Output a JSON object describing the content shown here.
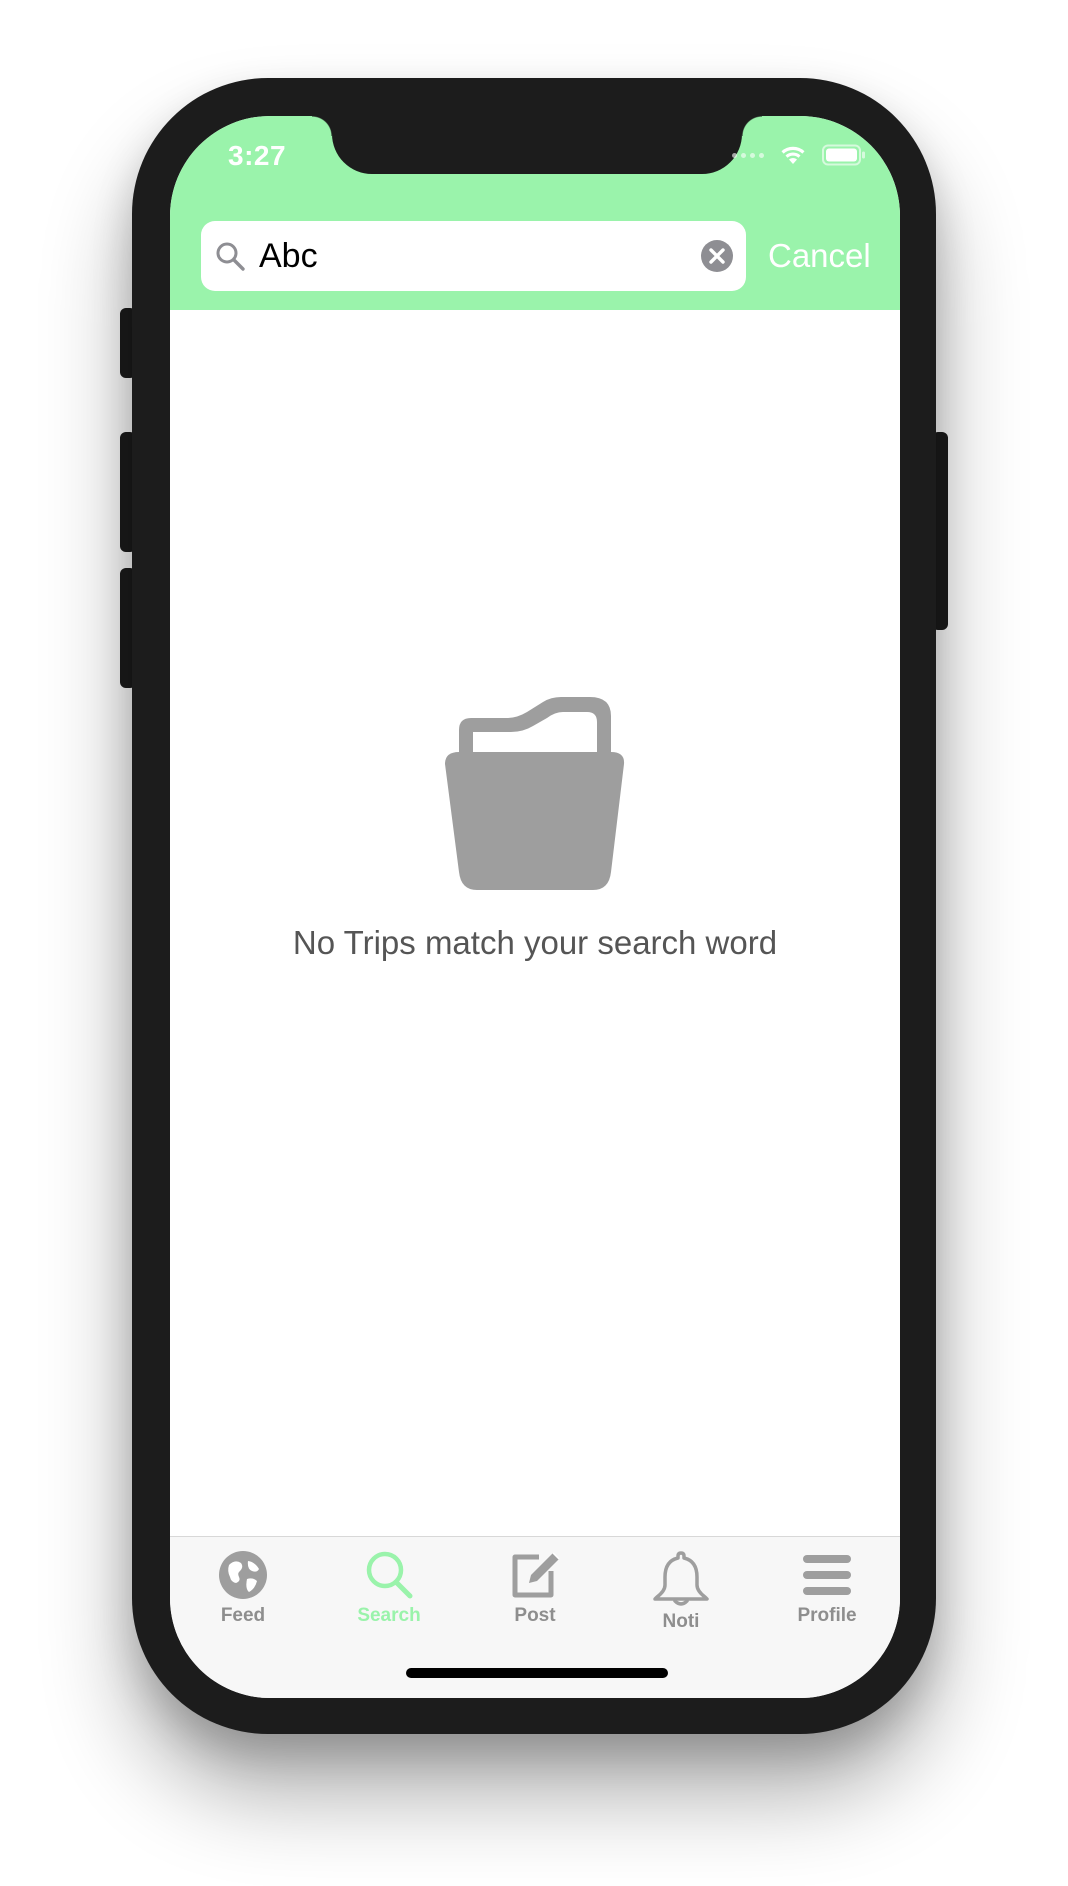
{
  "status_bar": {
    "time": "3:27"
  },
  "search": {
    "query": "Abc",
    "cancel_label": "Cancel"
  },
  "empty_state": {
    "message": "No Trips match your search word",
    "icon": "folder-icon"
  },
  "tab_bar": {
    "active": "Search",
    "items": [
      {
        "label": "Feed",
        "icon": "globe-icon"
      },
      {
        "label": "Search",
        "icon": "search-icon"
      },
      {
        "label": "Post",
        "icon": "compose-icon"
      },
      {
        "label": "Noti",
        "icon": "bell-icon"
      },
      {
        "label": "Profile",
        "icon": "menu-icon"
      }
    ]
  },
  "colors": {
    "accent": "#9af3ab",
    "icon_gray": "#9e9e9e",
    "frame": "#1c1c1c"
  }
}
